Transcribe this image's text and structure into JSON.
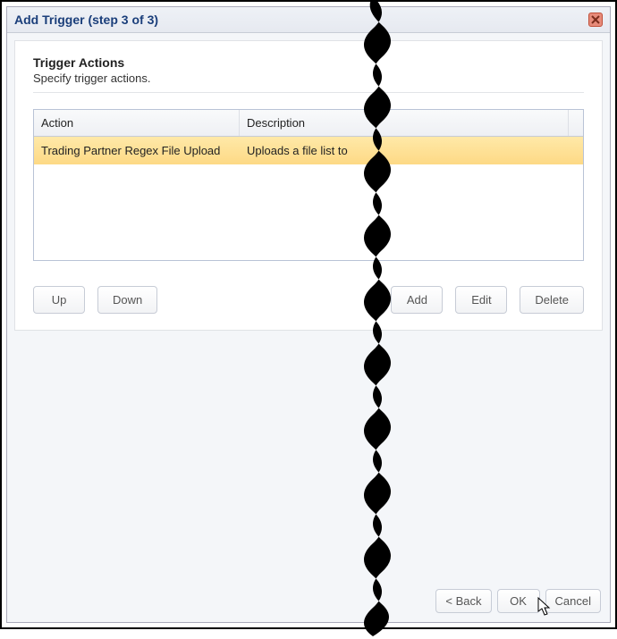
{
  "dialog": {
    "title": "Add Trigger (step 3 of 3)",
    "close_icon": "close"
  },
  "section": {
    "title": "Trigger Actions",
    "subtitle": "Specify trigger actions."
  },
  "table": {
    "headers": {
      "action": "Action",
      "description": "Description"
    },
    "rows": [
      {
        "action": "Trading Partner Regex File Upload",
        "description": "Uploads a file list to",
        "selected": true
      }
    ]
  },
  "buttons": {
    "up": "Up",
    "down": "Down",
    "add": "Add",
    "edit": "Edit",
    "delete": "Delete"
  },
  "footer": {
    "back": "< Back",
    "ok": "OK",
    "cancel": "Cancel"
  }
}
